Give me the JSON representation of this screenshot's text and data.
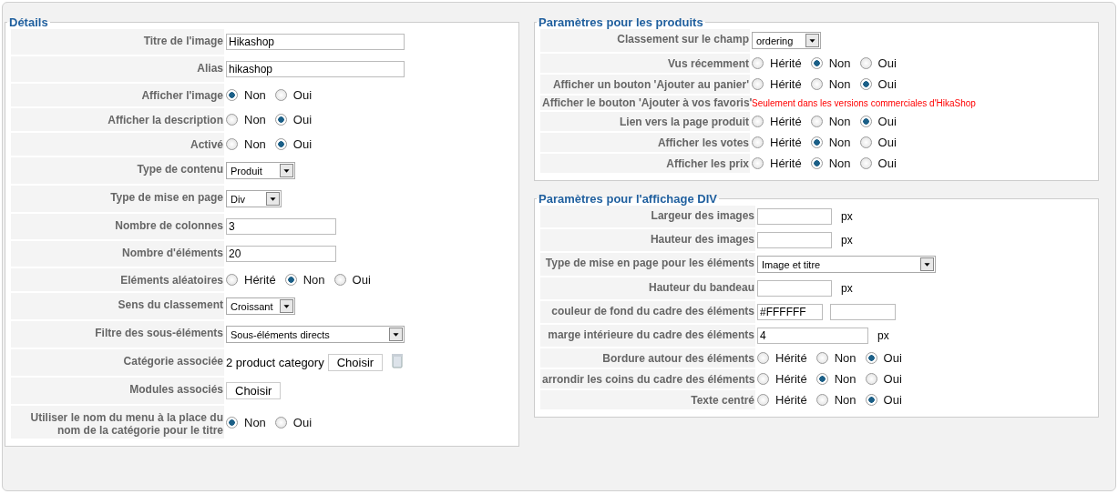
{
  "panels": [
    {
      "title": "Détails",
      "rows": [
        {
          "label": "Titre de l'image",
          "kind": "text",
          "value": "Hikashop"
        },
        {
          "label": "Alias",
          "kind": "text",
          "value": "hikashop"
        },
        {
          "label": "Afficher l'image",
          "kind": "radio",
          "options": [
            {
              "label": "Non",
              "selected": true
            },
            {
              "label": "Oui",
              "selected": false
            }
          ]
        },
        {
          "label": "Afficher la description",
          "kind": "radio",
          "options": [
            {
              "label": "Non",
              "selected": false
            },
            {
              "label": "Oui",
              "selected": true
            }
          ]
        },
        {
          "label": "Activé",
          "kind": "radio",
          "options": [
            {
              "label": "Non",
              "selected": false
            },
            {
              "label": "Oui",
              "selected": true
            }
          ]
        },
        {
          "label": "Type de contenu",
          "kind": "select",
          "value": "Produit"
        },
        {
          "label": "Type de mise en page",
          "kind": "select",
          "value": "Div"
        },
        {
          "label": "Nombre de colonnes",
          "kind": "text",
          "value": "3"
        },
        {
          "label": "Nombre d'éléments",
          "kind": "text",
          "value": "20"
        },
        {
          "label": "Eléments aléatoires",
          "kind": "radio",
          "options": [
            {
              "label": "Hérité",
              "selected": false
            },
            {
              "label": "Non",
              "selected": true
            },
            {
              "label": "Oui",
              "selected": false
            }
          ]
        },
        {
          "label": "Sens du classement",
          "kind": "select",
          "value": "Croissant"
        },
        {
          "label": "Filtre des sous-éléments",
          "kind": "select",
          "value": "Sous-éléments directs"
        },
        {
          "label": "Catégorie associée",
          "kind": "category",
          "text": "2 product category",
          "button": "Choisir"
        },
        {
          "label": "Modules associés",
          "kind": "button",
          "button": "Choisir"
        },
        {
          "label": "Utiliser le nom du menu à la place du nom de la catégorie pour le titre",
          "kind": "radio",
          "options": [
            {
              "label": "Non",
              "selected": true
            },
            {
              "label": "Oui",
              "selected": false
            }
          ]
        }
      ]
    },
    {
      "title": "Paramètres pour les produits",
      "rows": [
        {
          "label": "Classement sur le champ",
          "kind": "select",
          "value": "ordering"
        },
        {
          "label": "Vus récemment",
          "kind": "radio",
          "options": [
            {
              "label": "Hérité",
              "selected": false
            },
            {
              "label": "Non",
              "selected": true
            },
            {
              "label": "Oui",
              "selected": false
            }
          ]
        },
        {
          "label": "Afficher un bouton 'Ajouter au panier'",
          "kind": "radio",
          "options": [
            {
              "label": "Hérité",
              "selected": false
            },
            {
              "label": "Non",
              "selected": false
            },
            {
              "label": "Oui",
              "selected": true
            }
          ]
        },
        {
          "label": "Afficher le bouton 'Ajouter à vos favoris'",
          "kind": "note",
          "text": "Seulement dans les versions commerciales d'HikaShop"
        },
        {
          "label": "Lien vers la page produit",
          "kind": "radio",
          "options": [
            {
              "label": "Hérité",
              "selected": false
            },
            {
              "label": "Non",
              "selected": false
            },
            {
              "label": "Oui",
              "selected": true
            }
          ]
        },
        {
          "label": "Afficher les votes",
          "kind": "radio",
          "options": [
            {
              "label": "Hérité",
              "selected": false
            },
            {
              "label": "Non",
              "selected": true
            },
            {
              "label": "Oui",
              "selected": false
            }
          ]
        },
        {
          "label": "Afficher les prix",
          "kind": "radio",
          "options": [
            {
              "label": "Hérité",
              "selected": false
            },
            {
              "label": "Non",
              "selected": true
            },
            {
              "label": "Oui",
              "selected": false
            }
          ]
        }
      ]
    },
    {
      "title": "Paramètres pour l'affichage DIV",
      "rows": [
        {
          "label": "Largeur des images",
          "kind": "unit",
          "unit": "px"
        },
        {
          "label": "Hauteur des images",
          "kind": "unit",
          "unit": "px"
        },
        {
          "label": "Type de mise en page pour les éléments",
          "kind": "select",
          "value": "Image et titre"
        },
        {
          "label": "Hauteur du bandeau",
          "kind": "unit",
          "unit": "px"
        },
        {
          "label": "couleur de fond du cadre des éléments",
          "kind": "color",
          "value": "#FFFFFF"
        },
        {
          "label": "marge intérieure du cadre des éléments",
          "kind": "unit",
          "value": "4",
          "unit": "px"
        },
        {
          "label": "Bordure autour des éléments",
          "kind": "radio",
          "options": [
            {
              "label": "Hérité",
              "selected": false
            },
            {
              "label": "Non",
              "selected": false
            },
            {
              "label": "Oui",
              "selected": true
            }
          ]
        },
        {
          "label": "arrondir les coins du cadre des éléments",
          "kind": "radio",
          "options": [
            {
              "label": "Hérité",
              "selected": false
            },
            {
              "label": "Non",
              "selected": true
            },
            {
              "label": "Oui",
              "selected": false
            }
          ]
        },
        {
          "label": "Texte centré",
          "kind": "radio",
          "options": [
            {
              "label": "Hérité",
              "selected": false
            },
            {
              "label": "Non",
              "selected": false
            },
            {
              "label": "Oui",
              "selected": true
            }
          ]
        }
      ]
    }
  ]
}
